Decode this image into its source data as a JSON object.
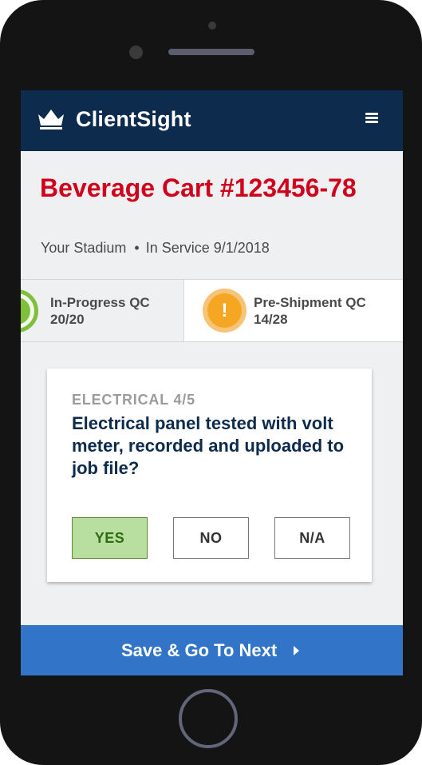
{
  "app": {
    "brand": "ClientSight",
    "logo_icon": "crown-icon",
    "menu_icon": "hamburger-menu-icon"
  },
  "asset": {
    "title": "Beverage Cart #123456-78",
    "location": "Your Stadium",
    "separator": "•",
    "service": "In Service 9/1/2018"
  },
  "qc_tabs": [
    {
      "label": "In-Progress QC",
      "count": "20/20",
      "icon": "check-circle-icon",
      "status_color": "#7fbf3b"
    },
    {
      "label": "Pre-Shipment QC",
      "count": "14/28",
      "icon": "warning-circle-icon",
      "icon_text": "!",
      "status_color": "#f5a623"
    }
  ],
  "question_card": {
    "category": "ELECTRICAL 4/5",
    "question": "Electrical panel tested with volt meter, recorded and uploaded to job file?",
    "answers": [
      "YES",
      "NO",
      "N/A"
    ],
    "selected": "YES"
  },
  "footer": {
    "save_label": "Save & Go To Next",
    "icon": "caret-right-icon"
  },
  "colors": {
    "header_bg": "#0c2b4d",
    "title_red": "#d0021b",
    "accent_blue": "#3275c8",
    "success_green": "#7fbf3b",
    "warning_orange": "#f5a623"
  }
}
